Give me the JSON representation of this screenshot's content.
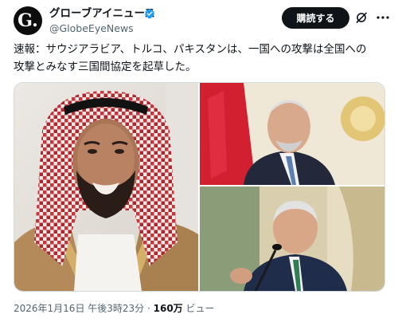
{
  "account": {
    "avatar_letter": "G.",
    "name": "グローブアイニュース",
    "handle": "@GlobeEyeNews"
  },
  "header": {
    "subscribe_label": "購読する"
  },
  "post": {
    "text": "速報：サウジアラビア、トルコ、パキスタンは、一国への攻撃は全国への\n攻撃とみなす三国間協定を起草した。"
  },
  "meta": {
    "datetime": "2026年1月16日 午後3時23分",
    "separator": " · ",
    "views_count": "160万",
    "views_label": " ビュー"
  },
  "colors": {
    "text": "#0f1419",
    "secondary_text": "#536471",
    "verified_badge": "#1d9bf0",
    "button_bg": "#0f1419",
    "border": "#cfd9de"
  },
  "icons": [
    "verified-badge-icon",
    "grok-icon",
    "more-icon"
  ]
}
